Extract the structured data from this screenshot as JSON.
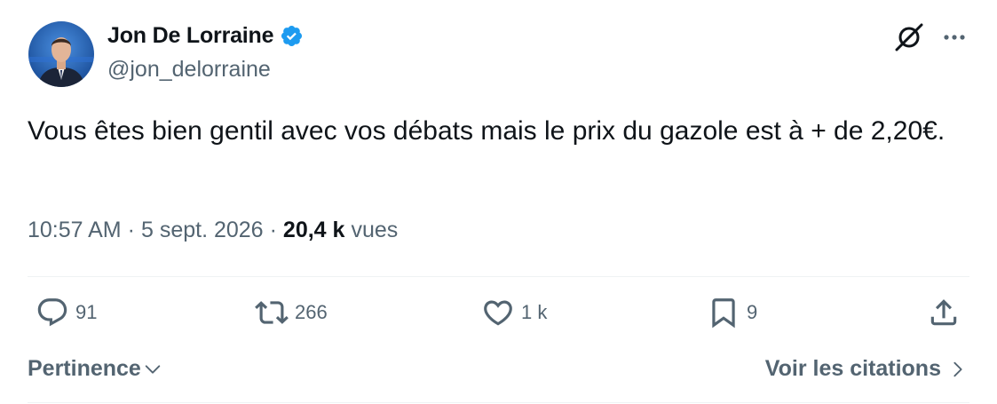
{
  "author": {
    "name": "Jon De Lorraine",
    "handle": "@jon_delorraine",
    "verified": true
  },
  "tweet": {
    "text": "Vous êtes bien gentil avec vos débats mais le prix du gazole est à + de 2,20€.",
    "time": "10:57 AM",
    "date": "5 sept. 2026",
    "separator": "·",
    "views_count": "20,4 k",
    "views_label": "vues"
  },
  "actions": {
    "replies": "91",
    "retweets": "266",
    "likes": "1 k",
    "bookmarks": "9"
  },
  "footer": {
    "sort_label": "Pertinence",
    "quotes_label": "Voir les citations"
  },
  "colors": {
    "text": "#0f1419",
    "secondary": "#536471",
    "verified": "#1d9bf0",
    "divider": "#eff3f4"
  },
  "icons": [
    "avatar-photo",
    "verified-badge-icon",
    "grok-icon",
    "more-icon",
    "reply-icon",
    "retweet-icon",
    "like-icon",
    "bookmark-icon",
    "share-icon",
    "chevron-down-icon",
    "chevron-right-icon"
  ]
}
